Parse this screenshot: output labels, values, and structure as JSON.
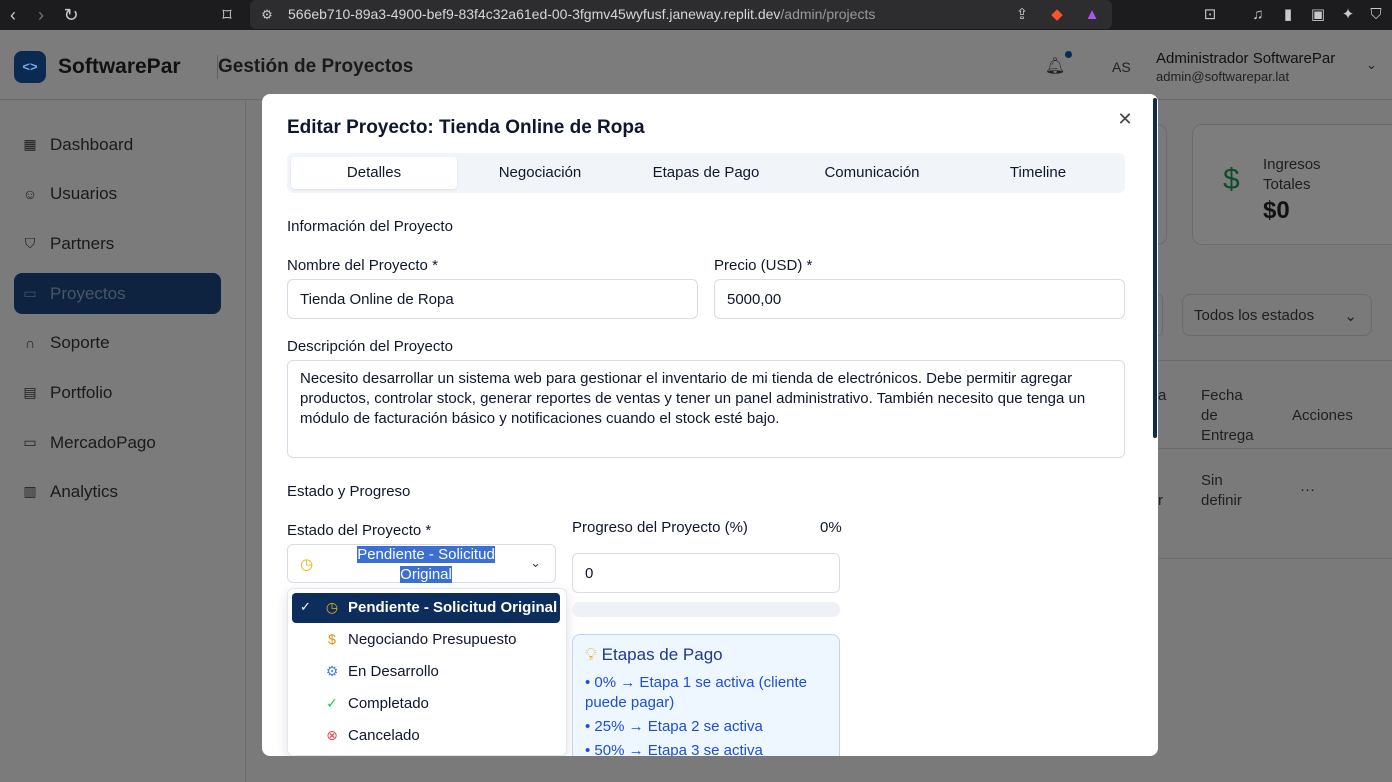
{
  "browser": {
    "url_main": "566eb710-89a3-4900-bef9-83f4c32a61ed-00-3fgmv45wyfusf.janeway.replit.dev",
    "url_path": "/admin/projects"
  },
  "header": {
    "brand": "SoftwarePar",
    "section": "Gestión de Proyectos",
    "avatar_initials": "AS",
    "admin_name": "Administrador SoftwarePar",
    "admin_email": "admin@softwarepar.lat"
  },
  "sidebar": {
    "items": [
      {
        "label": "Dashboard",
        "icon": "grid-icon"
      },
      {
        "label": "Usuarios",
        "icon": "users-icon"
      },
      {
        "label": "Partners",
        "icon": "handshake-icon"
      },
      {
        "label": "Proyectos",
        "icon": "folder-icon"
      },
      {
        "label": "Soporte",
        "icon": "headset-icon"
      },
      {
        "label": "Portfolio",
        "icon": "briefcase-icon"
      },
      {
        "label": "MercadoPago",
        "icon": "card-icon"
      },
      {
        "label": "Analytics",
        "icon": "bar-chart-icon"
      }
    ],
    "active": "Proyectos"
  },
  "stats": {
    "income_label": "Ingresos Totales",
    "income_value": "$0"
  },
  "filters": {
    "status_filter": "Todos los estados"
  },
  "table": {
    "headers": {
      "col_partial": "a",
      "delivery": "Fecha de Entrega",
      "actions": "Acciones"
    },
    "row": {
      "partial": "r",
      "delivery": "Sin definir",
      "actions": "···"
    }
  },
  "modal": {
    "title": "Editar Proyecto: Tienda Online de Ropa",
    "tabs": [
      "Detalles",
      "Negociación",
      "Etapas de Pago",
      "Comunicación",
      "Timeline"
    ],
    "active_tab": "Detalles",
    "info_section": "Información del Proyecto",
    "name_label": "Nombre del Proyecto *",
    "name_value": "Tienda Online de Ropa",
    "price_label": "Precio (USD) *",
    "price_value": "5000,00",
    "description_label": "Descripción del Proyecto",
    "description_value": "Necesito desarrollar un sistema web para gestionar el inventario de mi tienda de electrónicos. Debe permitir agregar productos, controlar stock, generar reportes de ventas y tener un panel administrativo. También necesito que tenga un módulo de facturación básico y notificaciones cuando el stock esté bajo.",
    "status_section": "Estado y Progreso",
    "status_label": "Estado del Proyecto *",
    "status_value": "Pendiente - Solicitud Original",
    "status_options": [
      {
        "label": "Pendiente - Solicitud Original",
        "icon": "clock-icon",
        "color": "#eab308"
      },
      {
        "label": "Negociando Presupuesto",
        "icon": "dollar-icon",
        "color": "#ea8a0c"
      },
      {
        "label": "En Desarrollo",
        "icon": "gear-icon",
        "color": "#3b82f6"
      },
      {
        "label": "Completado",
        "icon": "check-circle-icon",
        "color": "#22c55e"
      },
      {
        "label": "Cancelado",
        "icon": "x-circle-icon",
        "color": "#ef4444"
      }
    ],
    "progress_label": "Progreso del Proyecto (%)",
    "progress_percent_text": "0%",
    "progress_value": "0",
    "progress_fraction": 0,
    "payment_info": {
      "title": "Etapas de Pago",
      "lines": [
        "• 0% → Etapa 1 se activa (cliente puede pagar)",
        "• 25% → Etapa 2 se activa",
        "• 50% → Etapa 3 se activa"
      ]
    }
  },
  "colors": {
    "primary": "#0d2d5c",
    "selection": "#3b6fd4"
  }
}
